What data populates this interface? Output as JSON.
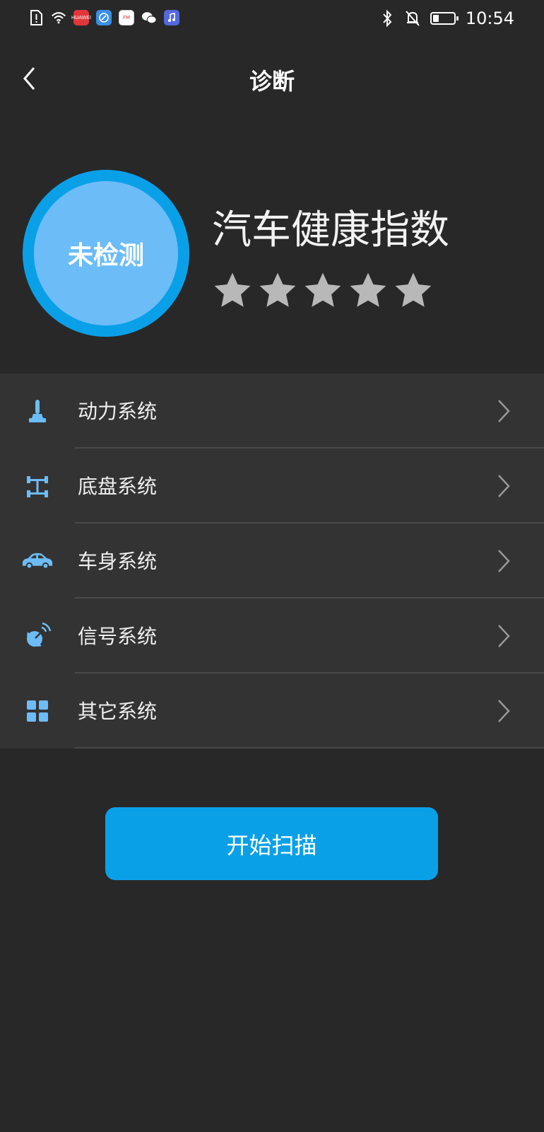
{
  "status_bar": {
    "time": "10:54",
    "battery_level": 0.3,
    "app_badges": [
      "HUAWEI",
      "FM"
    ]
  },
  "header": {
    "title": "诊断",
    "back_icon": "chevron-left-icon"
  },
  "health": {
    "status_text": "未检测",
    "title": "汽车健康指数",
    "stars_total": 5,
    "stars_filled": 0,
    "ring_color": "#0aa0e8",
    "inner_color": "#6cbcf8"
  },
  "systems": [
    {
      "label": "动力系统",
      "icon": "gear-shift-icon"
    },
    {
      "label": "底盘系统",
      "icon": "chassis-icon"
    },
    {
      "label": "车身系统",
      "icon": "car-icon"
    },
    {
      "label": "信号系统",
      "icon": "satellite-dish-icon"
    },
    {
      "label": "其它系统",
      "icon": "grid-icon"
    }
  ],
  "scan_button": {
    "label": "开始扫描",
    "color": "#0aa0e8"
  },
  "colors": {
    "background": "#282828",
    "list_background": "#333333",
    "icon_blue": "#6cbcf8",
    "star_grey": "#b8b8b8"
  }
}
